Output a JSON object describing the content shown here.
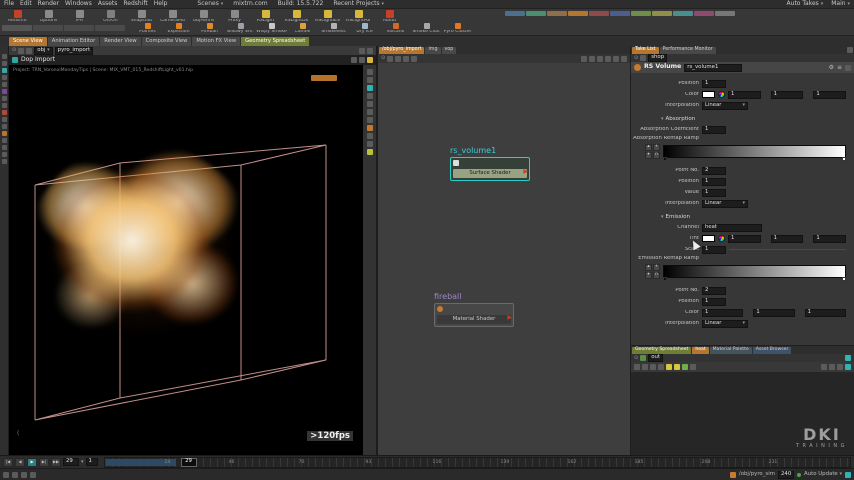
{
  "menubar": {
    "menus": [
      "File",
      "Edit",
      "Render",
      "Windows",
      "Assets",
      "Redshift",
      "Help"
    ],
    "scenes": "Scenes",
    "site": "mixtrn.com",
    "build": "Build: 15.5.722",
    "recent": "Recent Projects",
    "auto_takes": "Auto Takes",
    "take": "Main"
  },
  "shelf": {
    "row1": [
      {
        "label": "Redshift"
      },
      {
        "label": "Options"
      },
      {
        "label": "IPR"
      },
      {
        "label": "On/Off"
      },
      {
        "label": "Snapshot"
      },
      {
        "label": "CameraMo"
      },
      {
        "label": "ObjParms"
      },
      {
        "label": "Proxy"
      },
      {
        "label": "RSLight"
      },
      {
        "label": "RSLightDo"
      },
      {
        "label": "RSLightIES"
      },
      {
        "label": "RSLightPor"
      },
      {
        "label": "About"
      }
    ],
    "row2": [
      {
        "label": "Flames"
      },
      {
        "label": "Explosion"
      },
      {
        "label": "Fireball"
      },
      {
        "label": "Billowy Sm."
      },
      {
        "label": "Wispy Smoke"
      },
      {
        "label": "Candle"
      },
      {
        "label": "Smokeless"
      },
      {
        "label": "Dry Ice"
      },
      {
        "label": "Volcano"
      },
      {
        "label": "Smoke Clus."
      },
      {
        "label": "Pyro Cluster"
      }
    ]
  },
  "pane_tabs": {
    "view": [
      "Scene View",
      "Animation Editor",
      "Render View",
      "Composite View",
      "Motion FX View",
      "Geometry Spreadsheet"
    ],
    "net": [
      "/obj/pyro_import",
      "img",
      "vop"
    ],
    "params": [
      "Take List",
      "Performance Monitor"
    ]
  },
  "viewport": {
    "path_root": "obj",
    "path_node": "pyro_import",
    "header": "Dop Import",
    "project_line": "Project: TRN_VoronoiMondayTips | Scene: MIX_VMT_015_RedshiftLight_v01.hip",
    "fps": ">120fps",
    "paren": "("
  },
  "network": {
    "node1_name": "rs_volume1",
    "node1_tag": "Surface Shader",
    "node2_name": "fireball",
    "node2_tag": "Material Shader"
  },
  "params": {
    "path": "shop",
    "type_label": "RS Volume",
    "node_name": "rs_volume1",
    "position_label": "Position",
    "position_value": "1",
    "color_label": "Color",
    "color_v1": "1",
    "color_v2": "1",
    "color_v3": "1",
    "interp1_label": "Interpolation",
    "interp1_value": "Linear",
    "absorption_section": "Absorption",
    "abs_coeff_label": "Absorption Coefficient",
    "abs_coeff_value": "1",
    "abs_ramp_label": "Absorption Remap Ramp",
    "abs_point_label": "Point No.",
    "abs_point_value": "2",
    "abs_pos_label": "Position",
    "abs_pos_value": "1",
    "abs_value_label": "Value",
    "abs_value_value": "1",
    "interp2_label": "Interpolation",
    "interp2_value": "Linear",
    "emission_section": "Emission",
    "channel_label": "Channel",
    "channel_value": "heat",
    "tint_label": "Tint",
    "tint_v1": "1",
    "tint_v2": "1",
    "tint_v3": "1",
    "scale_label": "Scale",
    "scale_value": "1",
    "em_ramp_label": "Emission Remap Ramp",
    "em_point_label": "Point No.",
    "em_point_value": "2",
    "em_pos_label": "Position",
    "em_pos_value": "1",
    "em_color_label": "Color",
    "em_color_v1": "1",
    "em_color_v2": "1",
    "em_color_v3": "1",
    "interp3_label": "Interpolation",
    "interp3_value": "Linear"
  },
  "sheet": {
    "tabs": [
      "Geometry Spreadsheet",
      "heat",
      "Material Palette",
      "Asset Browser"
    ],
    "path": "out"
  },
  "watermark": {
    "line1": "DKI",
    "line2": "TRAINING"
  },
  "timeline": {
    "buttons": [
      "|◀",
      "◀",
      "▶",
      "▶|",
      "▶▶"
    ],
    "frame": "29",
    "step": "1",
    "labels": [
      "24",
      "46",
      "70",
      "93",
      "116",
      "139",
      "162",
      "185",
      "208",
      "231"
    ]
  },
  "statusbar": {
    "path": "/obj/pyro_sim",
    "end_frame": "240",
    "auto_update": "Auto Update"
  },
  "icons": {
    "caret_down": "▾",
    "caret_up": "▴",
    "plus": "+",
    "n": "n",
    "gear": "⚙",
    "menu": "≡",
    "pin": "⊙",
    "play": "▶"
  },
  "colors": {
    "accent_orange": "#b5772f",
    "node_teal": "#25cfc7",
    "label_purple": "#9d86c9",
    "tab_green": "#6e7e35",
    "cache_blue": "#2c4a66"
  }
}
